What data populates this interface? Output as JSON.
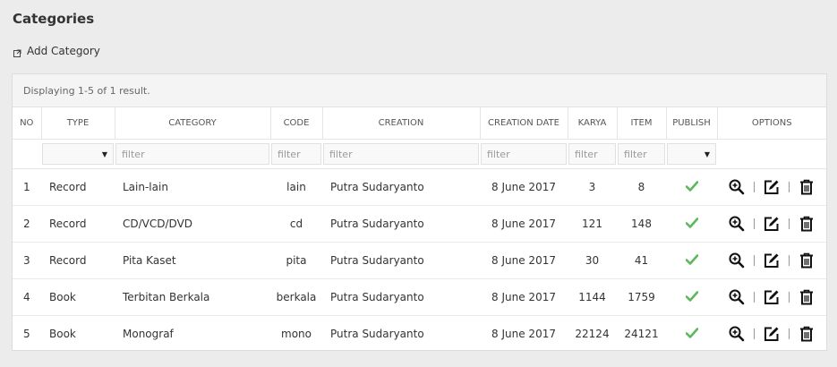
{
  "page": {
    "title": "Categories",
    "add_label": "Add Category"
  },
  "grid": {
    "summary": "Displaying 1-5 of 1 result.",
    "columns": [
      "NO",
      "TYPE",
      "CATEGORY",
      "CODE",
      "CREATION",
      "CREATION DATE",
      "KARYA",
      "ITEM",
      "PUBLISH",
      "OPTIONS"
    ],
    "filter_placeholder": "filter",
    "rows": [
      {
        "no": "1",
        "type": "Record",
        "category": "Lain-lain",
        "code": "lain",
        "creation": "Putra Sudaryanto",
        "date": "8 June 2017",
        "karya": "3",
        "item": "8",
        "published": true
      },
      {
        "no": "2",
        "type": "Record",
        "category": "CD/VCD/DVD",
        "code": "cd",
        "creation": "Putra Sudaryanto",
        "date": "8 June 2017",
        "karya": "121",
        "item": "148",
        "published": true
      },
      {
        "no": "3",
        "type": "Record",
        "category": "Pita Kaset",
        "code": "pita",
        "creation": "Putra Sudaryanto",
        "date": "8 June 2017",
        "karya": "30",
        "item": "41",
        "published": true
      },
      {
        "no": "4",
        "type": "Book",
        "category": "Terbitan Berkala",
        "code": "berkala",
        "creation": "Putra Sudaryanto",
        "date": "8 June 2017",
        "karya": "1144",
        "item": "1759",
        "published": true
      },
      {
        "no": "5",
        "type": "Book",
        "category": "Monograf",
        "code": "mono",
        "creation": "Putra Sudaryanto",
        "date": "8 June 2017",
        "karya": "22124",
        "item": "24121",
        "published": true
      }
    ]
  },
  "icons": {
    "add": "external-link-icon",
    "publish": "check-icon",
    "view": "zoom-in-icon",
    "edit": "edit-icon",
    "delete": "trash-icon"
  },
  "colors": {
    "check": "#5cb85c",
    "background": "#ececec",
    "panel": "#ffffff"
  }
}
